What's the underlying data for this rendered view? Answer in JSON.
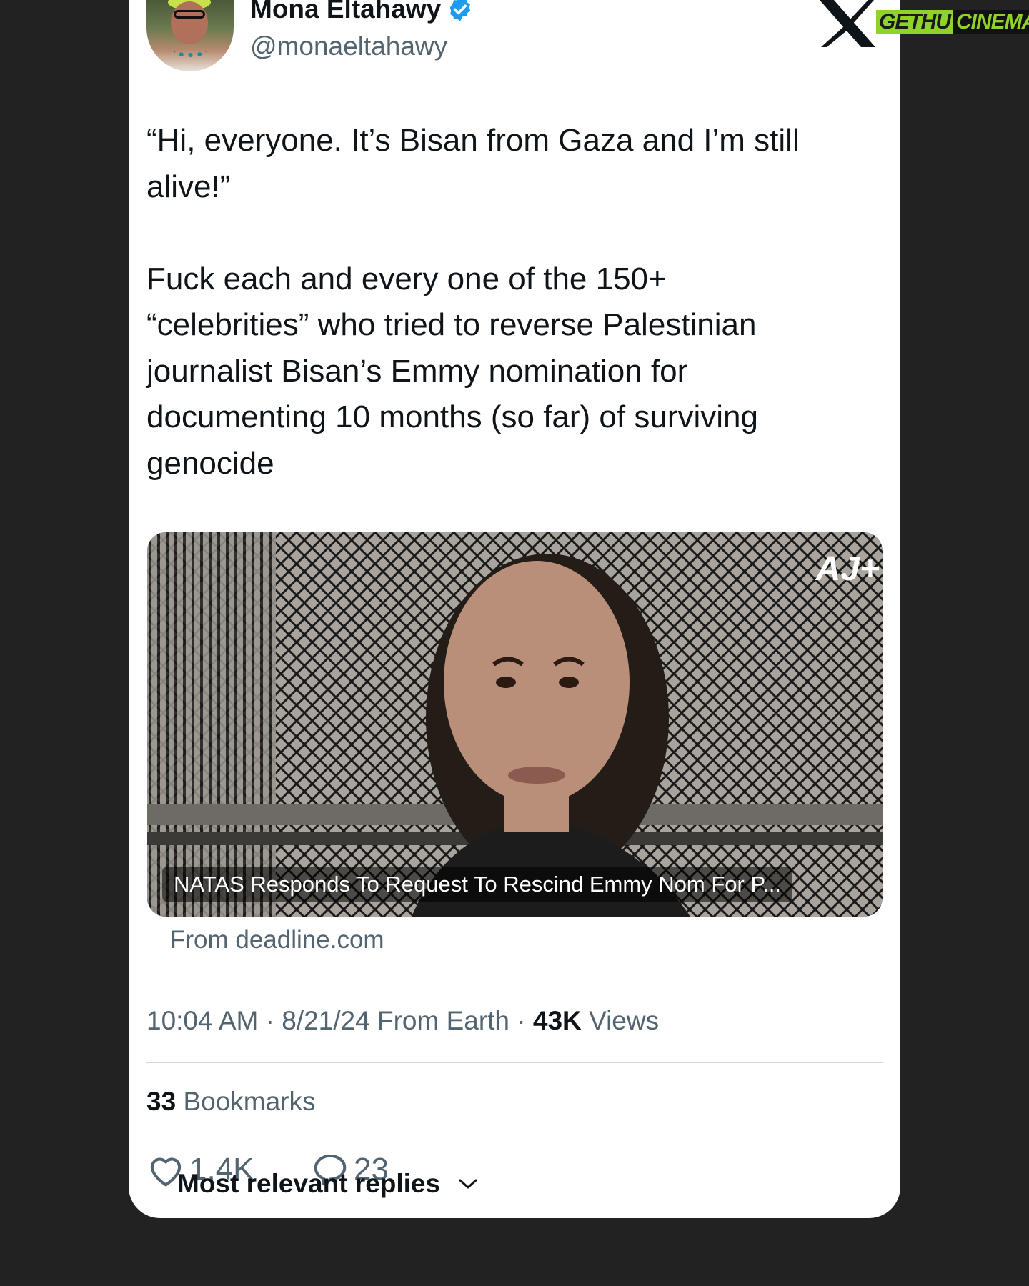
{
  "tweet": {
    "author_name": "Mona Eltahawy",
    "handle": "@monaeltahawy",
    "text": "“Hi, everyone. It’s Bisan from Gaza and I’m still\nalive!”\n\nFuck each and every one of the 150+\n“celebrities” who tried to reverse Palestinian\njournalist Bisan’s Emmy nomination for\ndocumenting 10 months (so far) of surviving\ngenocide",
    "media_caption": "NATAS Responds To Request To Rescind Emmy Nom For P...",
    "media_logo": "AJ+",
    "source": "From deadline.com",
    "time": "10:04 AM",
    "date": "8/21/24",
    "location": "From Earth",
    "views_count": "43K",
    "views_label": "Views",
    "bookmarks_count": "33",
    "bookmarks_label": "Bookmarks",
    "likes": "1.4K",
    "replies": "23",
    "sort_label": "Most relevant replies"
  },
  "watermark": {
    "part1": "GETHU",
    "part2": "CINEMA"
  },
  "colors": {
    "accent": "#1d9bf0",
    "muted": "#536471",
    "text": "#0f1419",
    "watermark": "#8fd22a"
  }
}
